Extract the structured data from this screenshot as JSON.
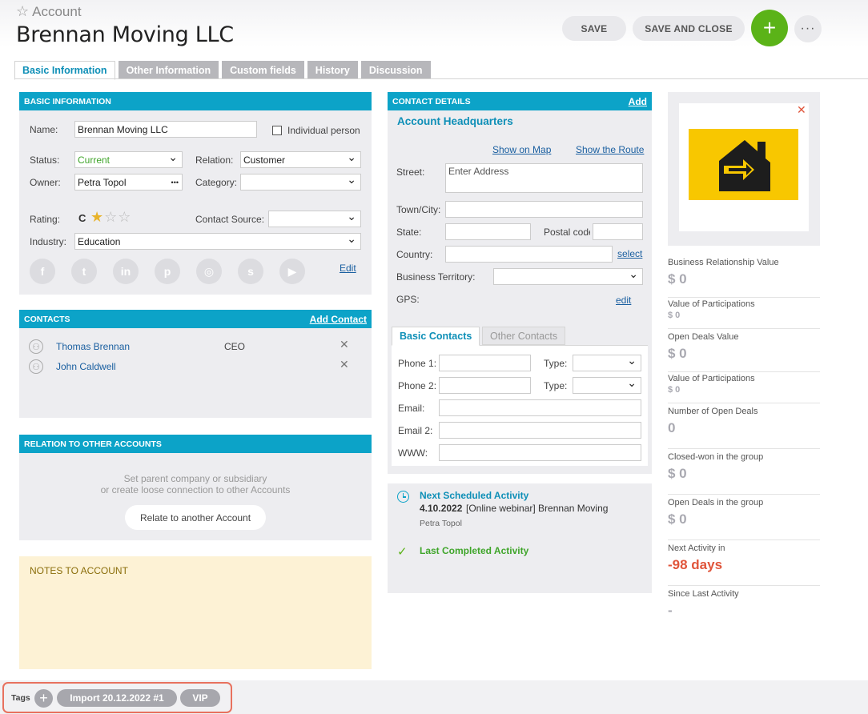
{
  "header": {
    "breadcrumb": "Account",
    "title": "Brennan Moving LLC",
    "save_label": "SAVE",
    "save_close_label": "SAVE AND CLOSE",
    "add_label": "+",
    "more_label": "···"
  },
  "tabs": [
    {
      "label": "Basic Information",
      "active": true
    },
    {
      "label": "Other Information",
      "active": false
    },
    {
      "label": "Custom fields",
      "active": false
    },
    {
      "label": "History",
      "active": false
    },
    {
      "label": "Discussion",
      "active": false
    }
  ],
  "basic": {
    "heading": "BASIC INFORMATION",
    "name_label": "Name:",
    "name_value": "Brennan Moving LLC",
    "individual_label": "Individual person",
    "status_label": "Status:",
    "status_value": "Current",
    "relation_label": "Relation:",
    "relation_value": "Customer",
    "owner_label": "Owner:",
    "owner_value": "Petra Topol",
    "owner_more": "•••",
    "category_label": "Category:",
    "category_value": "",
    "rating_label": "Rating:",
    "rating_grade": "C",
    "rating_stars": 1,
    "rating_max": 3,
    "source_label": "Contact Source:",
    "source_value": "",
    "industry_label": "Industry:",
    "industry_value": "Education",
    "social_icons": [
      {
        "name": "facebook-icon",
        "glyph": "f"
      },
      {
        "name": "twitter-icon",
        "glyph": "t"
      },
      {
        "name": "linkedin-icon",
        "glyph": "in"
      },
      {
        "name": "pinterest-icon",
        "glyph": "p"
      },
      {
        "name": "instagram-icon",
        "glyph": "◎"
      },
      {
        "name": "skype-icon",
        "glyph": "s"
      },
      {
        "name": "youtube-icon",
        "glyph": "▶"
      }
    ],
    "edit_label": "Edit"
  },
  "contacts": {
    "heading": "CONTACTS",
    "add_label": "Add Contact",
    "items": [
      {
        "name": "Thomas Brennan",
        "role": "CEO"
      },
      {
        "name": "John Caldwell",
        "role": ""
      }
    ]
  },
  "relations": {
    "heading": "RELATION TO OTHER ACCOUNTS",
    "hint_line1": "Set parent company or subsidiary",
    "hint_line2": "or create loose connection to other Accounts",
    "button_label": "Relate to another Account"
  },
  "notes": {
    "heading": "NOTES TO ACCOUNT",
    "colors": {
      "bg": "#fdf2d5",
      "text": "#8a6d0a"
    }
  },
  "contact_details": {
    "heading": "CONTACT DETAILS",
    "add_label": "Add",
    "address_title": "Account Headquarters",
    "show_map": "Show on Map",
    "show_route": "Show the Route",
    "street_label": "Street:",
    "street_placeholder": "Enter Address",
    "town_label": "Town/City:",
    "state_label": "State:",
    "postal_label": "Postal code",
    "country_label": "Country:",
    "select_label": "select",
    "territory_label": "Business Territory:",
    "gps_label": "GPS:",
    "gps_edit": "edit",
    "subtabs": [
      {
        "label": "Basic Contacts",
        "active": true
      },
      {
        "label": "Other Contacts",
        "active": false
      }
    ],
    "phone1_label": "Phone 1:",
    "phone2_label": "Phone 2:",
    "type_label": "Type:",
    "email_label": "Email:",
    "email2_label": "Email 2:",
    "www_label": "WWW:"
  },
  "activity": {
    "next_title": "Next Scheduled Activity",
    "next_date": "4.10.2022",
    "next_subject": "[Online webinar] Brennan Moving",
    "next_owner": "Petra Topol",
    "last_title": "Last Completed Activity"
  },
  "stats": [
    {
      "label": "Business Relationship Value",
      "value": "$ 0",
      "style": "big"
    },
    {
      "label": "Value of Participations",
      "value": "$ 0",
      "style": "small"
    },
    {
      "label": "Open Deals Value",
      "value": "$ 0",
      "style": "big"
    },
    {
      "label": "Value of Participations",
      "value": "$ 0",
      "style": "small"
    },
    {
      "label": "Number of Open Deals",
      "value": "0",
      "style": "big"
    },
    {
      "label": "Closed-won in the group",
      "value": "$ 0",
      "style": "big"
    },
    {
      "label": "Open Deals in the group",
      "value": "$ 0",
      "style": "big"
    },
    {
      "label": "Next Activity in",
      "value": "-98 days",
      "style": "red"
    },
    {
      "label": "Since Last Activity",
      "value": "-",
      "style": "big"
    }
  ],
  "tags": {
    "label": "Tags",
    "add_label": "+",
    "items": [
      "Import 20.12.2022 #1",
      "VIP"
    ]
  },
  "colors": {
    "accent": "#0ca3c8",
    "green": "#5bb318",
    "status_green": "#3fa52a",
    "link": "#1a5fa0",
    "logo_yellow": "#f8c700",
    "highlight_border": "#e8715e"
  }
}
